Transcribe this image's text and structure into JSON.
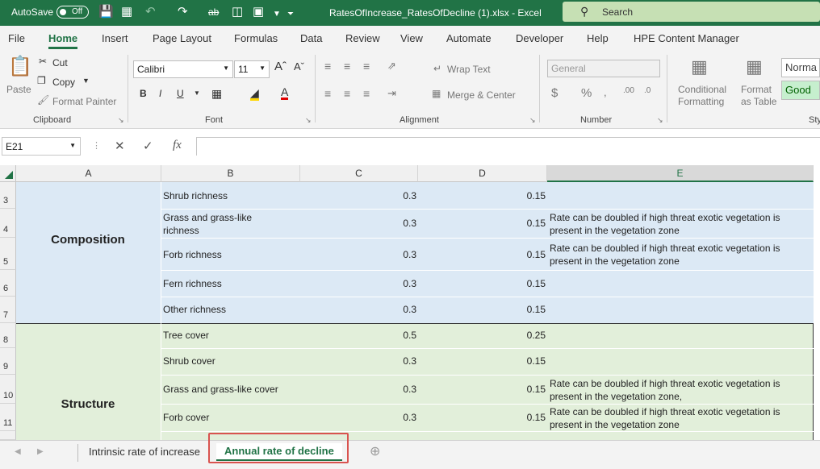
{
  "titlebar": {
    "autosave_label": "AutoSave",
    "autosave_state": "Off",
    "file_title": "RatesOfIncrease_RatesOfDecline (1).xlsx  -  Excel",
    "search_placeholder": "Search"
  },
  "tabs": [
    "File",
    "Home",
    "Insert",
    "Page Layout",
    "Formulas",
    "Data",
    "Review",
    "View",
    "Automate",
    "Developer",
    "Help",
    "HPE Content Manager"
  ],
  "ribbon": {
    "paste": "Paste",
    "cut": "Cut",
    "copy": "Copy",
    "format_painter": "Format Painter",
    "clipboard": "Clipboard",
    "font_name": "Calibri",
    "font_size": "11",
    "bold": "B",
    "italic": "I",
    "underline": "U",
    "font": "Font",
    "wrap_text": "Wrap Text",
    "merge_center": "Merge & Center",
    "alignment": "Alignment",
    "number_format": "General",
    "number": "Number",
    "conditional_formatting": "Conditional Formatting",
    "format_as_table": "Format as Table",
    "style_normal": "Norma",
    "style_good": "Good",
    "styles": "Sty"
  },
  "formula_bar": {
    "name_box": "E21",
    "fx": "fx",
    "content": ""
  },
  "columns": [
    "A",
    "B",
    "C",
    "D",
    "E"
  ],
  "rows": [
    {
      "num": "3",
      "b": "Shrub richness",
      "c": "0.3",
      "d": "0.15",
      "e": ""
    },
    {
      "num": "4",
      "b": "Grass and grass-like richness",
      "c": "0.3",
      "d": "0.15",
      "e": "Rate can be doubled if high threat exotic vegetation is present in the vegetation zone"
    },
    {
      "num": "5",
      "b": "Forb richness",
      "c": "0.3",
      "d": "0.15",
      "e": "Rate can be doubled if high threat exotic vegetation is present in the vegetation zone"
    },
    {
      "num": "6",
      "b": "Fern richness",
      "c": "0.3",
      "d": "0.15",
      "e": ""
    },
    {
      "num": "7",
      "b": "Other richness",
      "c": "0.3",
      "d": "0.15",
      "e": ""
    },
    {
      "num": "8",
      "b": "Tree cover",
      "c": "0.5",
      "d": "0.25",
      "e": ""
    },
    {
      "num": "9",
      "b": "Shrub cover",
      "c": "0.3",
      "d": "0.15",
      "e": ""
    },
    {
      "num": "10",
      "b": "Grass and grass-like cover",
      "c": "0.3",
      "d": "0.15",
      "e": "Rate can be doubled if high threat exotic vegetation is present in the vegetation zone,"
    },
    {
      "num": "11",
      "b": "Forb cover",
      "c": "0.3",
      "d": "0.15",
      "e": "Rate can be doubled if high threat exotic vegetation is present in the vegetation zone"
    }
  ],
  "groups": {
    "composition": "Composition",
    "structure": "Structure"
  },
  "sheet_tabs": [
    "Intrinsic rate of increase",
    "Annual rate of decline"
  ],
  "colors": {
    "excel_green": "#217346",
    "composition_bg": "#dce9f5",
    "structure_bg": "#e2efda",
    "highlight": "#d9534f"
  }
}
